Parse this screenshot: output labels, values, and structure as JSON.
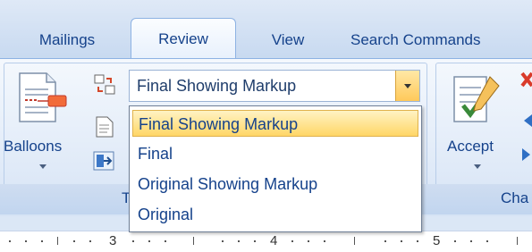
{
  "tabs": [
    {
      "label": "Mailings",
      "active": false
    },
    {
      "label": "Review",
      "active": true
    },
    {
      "label": "View",
      "active": false
    },
    {
      "label": "Search Commands",
      "active": false
    }
  ],
  "tracking": {
    "balloons_label": "Balloons",
    "group_label": "T",
    "display_combo_value": "Final Showing Markup",
    "display_options": [
      {
        "label": "Final Showing Markup",
        "selected": true
      },
      {
        "label": "Final",
        "selected": false
      },
      {
        "label": "Original Showing Markup",
        "selected": false
      },
      {
        "label": "Original",
        "selected": false
      }
    ]
  },
  "changes": {
    "accept_label": "Accept",
    "group_label": "Cha"
  },
  "ruler": {
    "numbers": [
      "3",
      "4",
      "5"
    ]
  },
  "colors": {
    "accent_text": "#15428b",
    "highlight": "#ffd667",
    "ribbon_bg": "#dbe7f6"
  }
}
